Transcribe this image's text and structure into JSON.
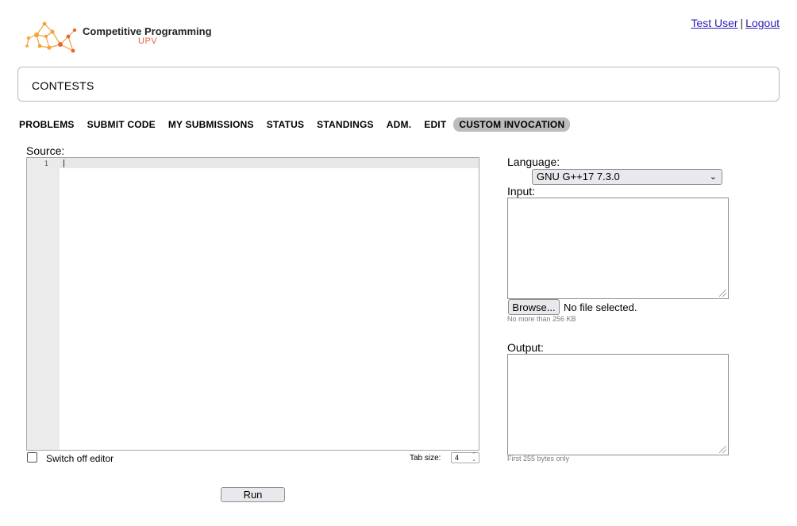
{
  "header": {
    "logo_title": "Competitive Programming",
    "logo_sub": "UPV",
    "user_name": "Test User",
    "separator": "|",
    "logout": "Logout"
  },
  "contests_label": "CONTESTS",
  "nav": {
    "items": [
      {
        "label": "PROBLEMS"
      },
      {
        "label": "SUBMIT CODE"
      },
      {
        "label": "MY SUBMISSIONS"
      },
      {
        "label": "STATUS"
      },
      {
        "label": "STANDINGS"
      },
      {
        "label": "ADM."
      },
      {
        "label": "EDIT"
      },
      {
        "label": "CUSTOM INVOCATION"
      }
    ],
    "active_index": 7
  },
  "source": {
    "label": "Source:",
    "line_number": "1",
    "switch_off_label": "Switch off editor",
    "tab_size_label": "Tab size:",
    "tab_size_value": "4"
  },
  "run_label": "Run",
  "language": {
    "label": "Language:",
    "selected": "GNU G++17 7.3.0"
  },
  "input": {
    "label": "Input:",
    "browse_label": "Browse...",
    "no_file": "No file selected.",
    "hint": "No more than 256 KB"
  },
  "output": {
    "label": "Output:",
    "hint": "First 255 bytes only"
  },
  "colors": {
    "logo_accent": "#f5a33a",
    "logo_sub": "#e8633a",
    "active_tab": "#bcbcbc",
    "link": "#2c1db5"
  }
}
